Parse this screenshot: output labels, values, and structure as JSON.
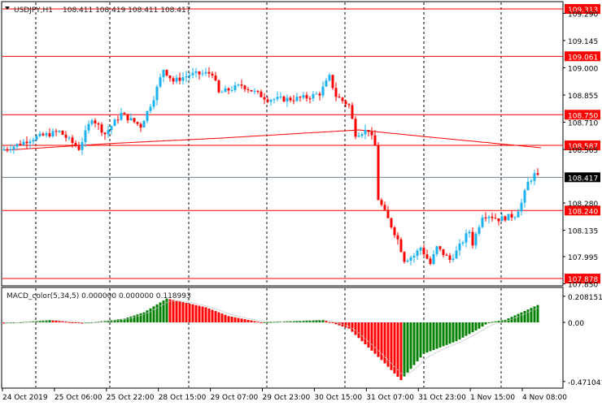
{
  "header": {
    "symbol": "USDJPY,H1",
    "ohlc": "108.411 108.419 108.411 108.417"
  },
  "macd": {
    "label": "MACD_color(5,34,5) 0.000000 0.000000 0.118993",
    "axis_labels": [
      "0.208151",
      "0.00",
      "-0.471041"
    ]
  },
  "colors": {
    "bull": "#1ab2f0",
    "bear": "#ff0000",
    "level": "#ff0000",
    "current": "#708090",
    "macd_up": "#008000",
    "macd_down": "#ff0000"
  },
  "chart_data": {
    "type": "candlestick",
    "price_range": [
      107.84,
      109.335
    ],
    "price_ticks": [
      "109.290",
      "109.145",
      "109.000",
      "108.855",
      "108.710",
      "108.565",
      "108.280",
      "108.135",
      "107.995",
      "107.850"
    ],
    "levels": [
      "109.313",
      "109.061",
      "108.750",
      "108.587",
      "108.240",
      "107.878"
    ],
    "current_price": "108.417",
    "time_labels": [
      "24 Oct 2019",
      "25 Oct 06:00",
      "25 Oct 22:00",
      "28 Oct 15:00",
      "29 Oct 07:00",
      "29 Oct 23:00",
      "30 Oct 15:00",
      "31 Oct 07:00",
      "31 Oct 23:00",
      "1 Nov 15:00",
      "4 Nov 08:00"
    ],
    "candle_count": 165,
    "close_keypoints": [
      [
        0,
        108.561
      ],
      [
        4,
        108.583
      ],
      [
        10,
        108.626
      ],
      [
        18,
        108.66
      ],
      [
        24,
        108.57
      ],
      [
        28,
        108.734
      ],
      [
        32,
        108.648
      ],
      [
        37,
        108.755
      ],
      [
        43,
        108.69
      ],
      [
        47,
        108.842
      ],
      [
        50,
        108.993
      ],
      [
        53,
        108.928
      ],
      [
        58,
        108.963
      ],
      [
        65,
        108.972
      ],
      [
        67,
        108.864
      ],
      [
        74,
        108.907
      ],
      [
        82,
        108.833
      ],
      [
        89,
        108.833
      ],
      [
        94,
        108.842
      ],
      [
        98,
        108.864
      ],
      [
        101,
        108.95
      ],
      [
        103,
        108.85
      ],
      [
        107,
        108.799
      ],
      [
        109,
        108.648
      ],
      [
        113,
        108.669
      ],
      [
        115,
        108.583
      ],
      [
        116,
        108.302
      ],
      [
        119,
        108.194
      ],
      [
        122,
        108.086
      ],
      [
        124,
        107.978
      ],
      [
        127,
        108.0
      ],
      [
        129,
        108.043
      ],
      [
        132,
        107.956
      ],
      [
        134,
        108.043
      ],
      [
        138,
        107.978
      ],
      [
        140,
        108.021
      ],
      [
        143,
        108.107
      ],
      [
        144,
        108.129
      ],
      [
        145,
        108.064
      ],
      [
        148,
        108.215
      ],
      [
        150,
        108.215
      ],
      [
        153,
        108.194
      ],
      [
        158,
        108.215
      ],
      [
        160,
        108.28
      ],
      [
        162,
        108.388
      ],
      [
        164,
        108.431
      ],
      [
        165,
        108.417
      ]
    ],
    "ma_keypoints": [
      [
        0,
        108.561
      ],
      [
        32,
        108.596
      ],
      [
        67,
        108.626
      ],
      [
        109,
        108.669
      ],
      [
        129,
        108.634
      ],
      [
        165,
        108.574
      ]
    ],
    "macd_range": [
      -0.48,
      0.26
    ],
    "macd_keypoints": [
      [
        0,
        -0.01
      ],
      [
        14,
        0.02
      ],
      [
        24,
        -0.01
      ],
      [
        37,
        0.03
      ],
      [
        43,
        0.08
      ],
      [
        50,
        0.19
      ],
      [
        62,
        0.12
      ],
      [
        69,
        0.05
      ],
      [
        79,
        0.0
      ],
      [
        98,
        0.02
      ],
      [
        106,
        -0.05
      ],
      [
        116,
        -0.3
      ],
      [
        122,
        -0.46
      ],
      [
        129,
        -0.25
      ],
      [
        139,
        -0.15
      ],
      [
        146,
        -0.05
      ],
      [
        149,
        0.0
      ],
      [
        154,
        0.02
      ],
      [
        165,
        0.15
      ]
    ]
  }
}
